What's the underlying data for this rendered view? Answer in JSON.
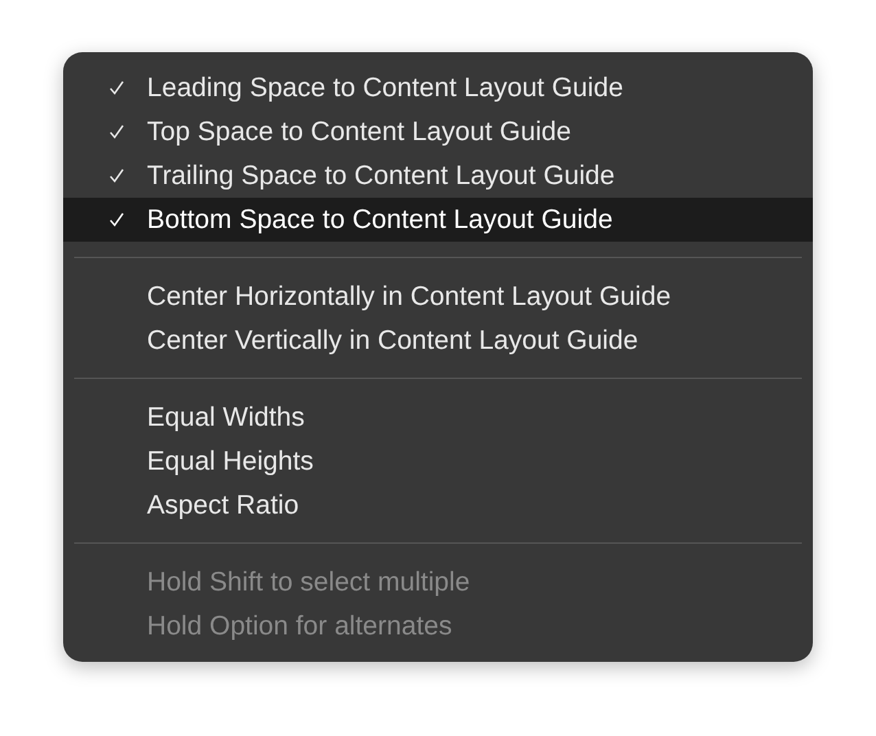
{
  "menu": {
    "sections": [
      {
        "items": [
          {
            "label": "Leading Space to Content Layout Guide",
            "checked": true,
            "selected": false,
            "disabled": false
          },
          {
            "label": "Top Space to Content Layout Guide",
            "checked": true,
            "selected": false,
            "disabled": false
          },
          {
            "label": "Trailing Space to Content Layout Guide",
            "checked": true,
            "selected": false,
            "disabled": false
          },
          {
            "label": "Bottom Space to Content Layout Guide",
            "checked": true,
            "selected": true,
            "disabled": false
          }
        ]
      },
      {
        "items": [
          {
            "label": "Center Horizontally in Content Layout Guide",
            "checked": false,
            "selected": false,
            "disabled": false
          },
          {
            "label": "Center Vertically in Content Layout Guide",
            "checked": false,
            "selected": false,
            "disabled": false
          }
        ]
      },
      {
        "items": [
          {
            "label": "Equal Widths",
            "checked": false,
            "selected": false,
            "disabled": false
          },
          {
            "label": "Equal Heights",
            "checked": false,
            "selected": false,
            "disabled": false
          },
          {
            "label": "Aspect Ratio",
            "checked": false,
            "selected": false,
            "disabled": false
          }
        ]
      },
      {
        "items": [
          {
            "label": "Hold Shift to select multiple",
            "checked": false,
            "selected": false,
            "disabled": true
          },
          {
            "label": "Hold Option for alternates",
            "checked": false,
            "selected": false,
            "disabled": true
          }
        ]
      }
    ]
  }
}
